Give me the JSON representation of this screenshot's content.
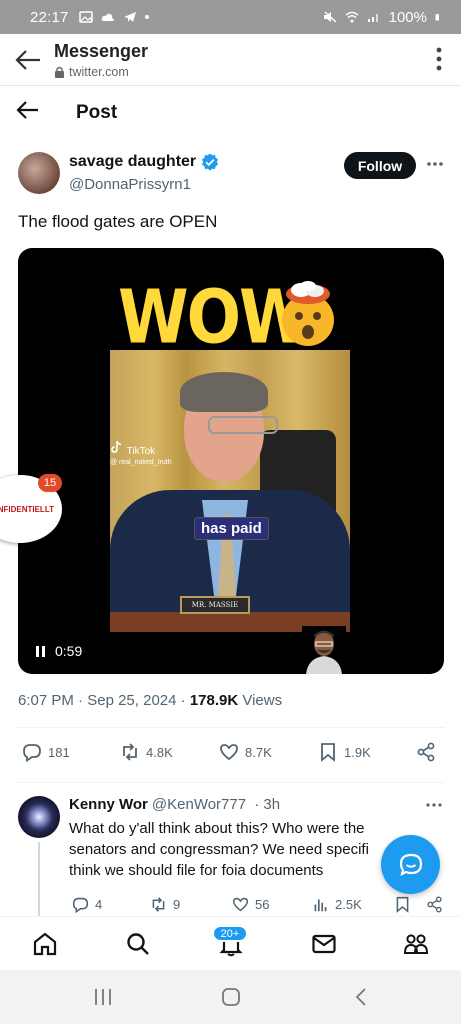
{
  "status_bar": {
    "time": "22:17",
    "battery": "100%"
  },
  "chrome": {
    "title": "Messenger",
    "url": "twitter.com"
  },
  "header": {
    "title": "Post"
  },
  "post": {
    "author_name": "savage daughter",
    "handle": "@DonnaPrissyrn1",
    "follow_label": "Follow",
    "text": "The flood gates are OPEN",
    "video": {
      "overlay_title": "WOW",
      "caption": "has paid",
      "nameplate": "MR. MASSIE",
      "watermark_brand": "TikTok",
      "watermark_user": "@ real_naked_truth",
      "duration": "0:59"
    },
    "time": "6:07 PM",
    "date": "Sep 25, 2024",
    "views_count": "178.9K",
    "views_label": "Views",
    "stats": {
      "replies": "181",
      "reposts": "4.8K",
      "likes": "8.7K",
      "bookmarks": "1.9K"
    }
  },
  "overlay_bubble": {
    "text": "ONFIDENTIELLT",
    "badge": "15"
  },
  "reply": {
    "author_name": "Kenny Wor",
    "handle": "@KenWor777",
    "age": "· 3h",
    "text": "What do y'all think about this? Who were the\nsenators and congressman? We need specifi\nthink we should file for foia documents",
    "stats": {
      "replies": "4",
      "reposts": "9",
      "likes": "56",
      "views": "2.5K"
    }
  },
  "bottom_nav": {
    "notifications_badge": "20+"
  },
  "colors": {
    "accent": "#1d9bf0",
    "text": "#0f1419",
    "muted": "#536471",
    "wow": "#ffd83a"
  }
}
